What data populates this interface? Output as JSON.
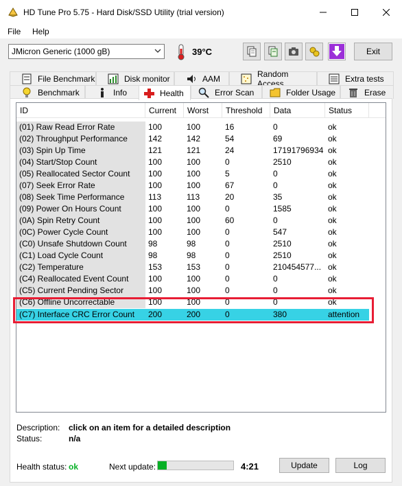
{
  "window": {
    "title": "HD Tune Pro 5.75 - Hard Disk/SSD Utility (trial version)"
  },
  "menu": {
    "file": "File",
    "help": "Help"
  },
  "toolbar": {
    "drive": "JMicron Generic (1000 gB)",
    "temperature": "39°C",
    "exit_label": "Exit",
    "buttons": [
      "copy-icon",
      "copy-info-icon",
      "screenshot-icon",
      "options-icon",
      "save-icon"
    ]
  },
  "tabs": {
    "row1": [
      {
        "label": "File Benchmark",
        "icon": "file-benchmark-icon"
      },
      {
        "label": "Disk monitor",
        "icon": "disk-monitor-icon"
      },
      {
        "label": "AAM",
        "icon": "speaker-icon"
      },
      {
        "label": "Random Access",
        "icon": "random-access-icon"
      },
      {
        "label": "Extra tests",
        "icon": "extra-tests-icon"
      }
    ],
    "row2": [
      {
        "label": "Benchmark",
        "icon": "lightbulb-icon"
      },
      {
        "label": "Info",
        "icon": "info-icon"
      },
      {
        "label": "Health",
        "icon": "health-cross-icon"
      },
      {
        "label": "Error Scan",
        "icon": "magnifier-icon"
      },
      {
        "label": "Folder Usage",
        "icon": "folder-icon"
      },
      {
        "label": "Erase",
        "icon": "trash-icon"
      }
    ]
  },
  "columns": [
    "ID",
    "Current",
    "Worst",
    "Threshold",
    "Data",
    "Status"
  ],
  "rows": [
    {
      "id": "(01) Raw Read Error Rate",
      "current": "100",
      "worst": "100",
      "threshold": "16",
      "data": "0",
      "status": "ok"
    },
    {
      "id": "(02) Throughput Performance",
      "current": "142",
      "worst": "142",
      "threshold": "54",
      "data": "69",
      "status": "ok"
    },
    {
      "id": "(03) Spin Up Time",
      "current": "121",
      "worst": "121",
      "threshold": "24",
      "data": "17191796934",
      "status": "ok"
    },
    {
      "id": "(04) Start/Stop Count",
      "current": "100",
      "worst": "100",
      "threshold": "0",
      "data": "2510",
      "status": "ok"
    },
    {
      "id": "(05) Reallocated Sector Count",
      "current": "100",
      "worst": "100",
      "threshold": "5",
      "data": "0",
      "status": "ok"
    },
    {
      "id": "(07) Seek Error Rate",
      "current": "100",
      "worst": "100",
      "threshold": "67",
      "data": "0",
      "status": "ok"
    },
    {
      "id": "(08) Seek Time Performance",
      "current": "113",
      "worst": "113",
      "threshold": "20",
      "data": "35",
      "status": "ok"
    },
    {
      "id": "(09) Power On Hours Count",
      "current": "100",
      "worst": "100",
      "threshold": "0",
      "data": "1585",
      "status": "ok"
    },
    {
      "id": "(0A) Spin Retry Count",
      "current": "100",
      "worst": "100",
      "threshold": "60",
      "data": "0",
      "status": "ok"
    },
    {
      "id": "(0C) Power Cycle Count",
      "current": "100",
      "worst": "100",
      "threshold": "0",
      "data": "547",
      "status": "ok"
    },
    {
      "id": "(C0) Unsafe Shutdown Count",
      "current": "98",
      "worst": "98",
      "threshold": "0",
      "data": "2510",
      "status": "ok"
    },
    {
      "id": "(C1) Load Cycle Count",
      "current": "98",
      "worst": "98",
      "threshold": "0",
      "data": "2510",
      "status": "ok"
    },
    {
      "id": "(C2) Temperature",
      "current": "153",
      "worst": "153",
      "threshold": "0",
      "data": "210454577...",
      "status": "ok"
    },
    {
      "id": "(C4) Reallocated Event Count",
      "current": "100",
      "worst": "100",
      "threshold": "0",
      "data": "0",
      "status": "ok"
    },
    {
      "id": "(C5) Current Pending Sector",
      "current": "100",
      "worst": "100",
      "threshold": "0",
      "data": "0",
      "status": "ok"
    },
    {
      "id": "(C6) Offline Uncorrectable",
      "current": "100",
      "worst": "100",
      "threshold": "0",
      "data": "0",
      "status": "ok"
    },
    {
      "id": "(C7) Interface CRC Error Count",
      "current": "200",
      "worst": "200",
      "threshold": "0",
      "data": "380",
      "status": "attention"
    }
  ],
  "description": {
    "label": "Description:",
    "value": "click on an item for a detailed description",
    "status_label": "Status:",
    "status_value": "n/a"
  },
  "footer": {
    "health_label": "Health status:",
    "health_value": "ok",
    "next_update_label": "Next update:",
    "progress_fraction": 0.12,
    "time": "4:21",
    "update_label": "Update",
    "log_label": "Log"
  },
  "colors": {
    "highlight_row": "#37d2e5",
    "highlight_box": "#e81d34",
    "health_ok": "#06b025"
  }
}
